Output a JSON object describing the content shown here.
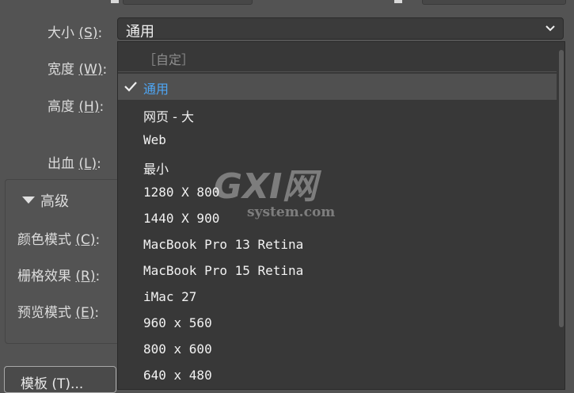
{
  "settings": {
    "size_label": "大小",
    "size_key": "(S)",
    "width_label": "宽度",
    "width_key": "(W)",
    "height_label": "高度",
    "height_key": "(H)",
    "bleed_label": "出血",
    "bleed_key": "(L)",
    "advanced_label": "高级",
    "color_mode_label": "颜色模式",
    "color_mode_key": "(C)",
    "raster_label": "栅格效果",
    "raster_key": "(R)",
    "preview_label": "预览模式",
    "preview_key": "(E)",
    "colon": ":",
    "template_button": "模板 (T)..."
  },
  "size_select": {
    "value": "通用"
  },
  "dropdown": {
    "options": [
      {
        "label": "［自定］",
        "state": "disabled"
      },
      {
        "label": "通用",
        "state": "selected"
      },
      {
        "label": "网页 - 大",
        "state": "normal"
      },
      {
        "label": "Web",
        "state": "normal"
      },
      {
        "label": "最小",
        "state": "normal"
      },
      {
        "label": "1280 X 800",
        "state": "normal"
      },
      {
        "label": "1440 X 900",
        "state": "normal"
      },
      {
        "label": "MacBook Pro 13 Retina",
        "state": "normal"
      },
      {
        "label": "MacBook Pro 15 Retina",
        "state": "normal"
      },
      {
        "label": "iMac 27",
        "state": "normal"
      },
      {
        "label": "960 x 560",
        "state": "normal"
      },
      {
        "label": "800 x 600",
        "state": "normal"
      },
      {
        "label": "640 x 480",
        "state": "normal"
      }
    ]
  },
  "watermark": {
    "logo": "GXI网",
    "domain": "system.com"
  },
  "colors": {
    "background": "#535353",
    "dropdown_bg": "#383838",
    "selected_text": "#4ea6f5",
    "text": "#dcdcdc"
  },
  "icons": [
    "chevron-down-icon",
    "checkmark-icon",
    "triangle-down-icon"
  ]
}
